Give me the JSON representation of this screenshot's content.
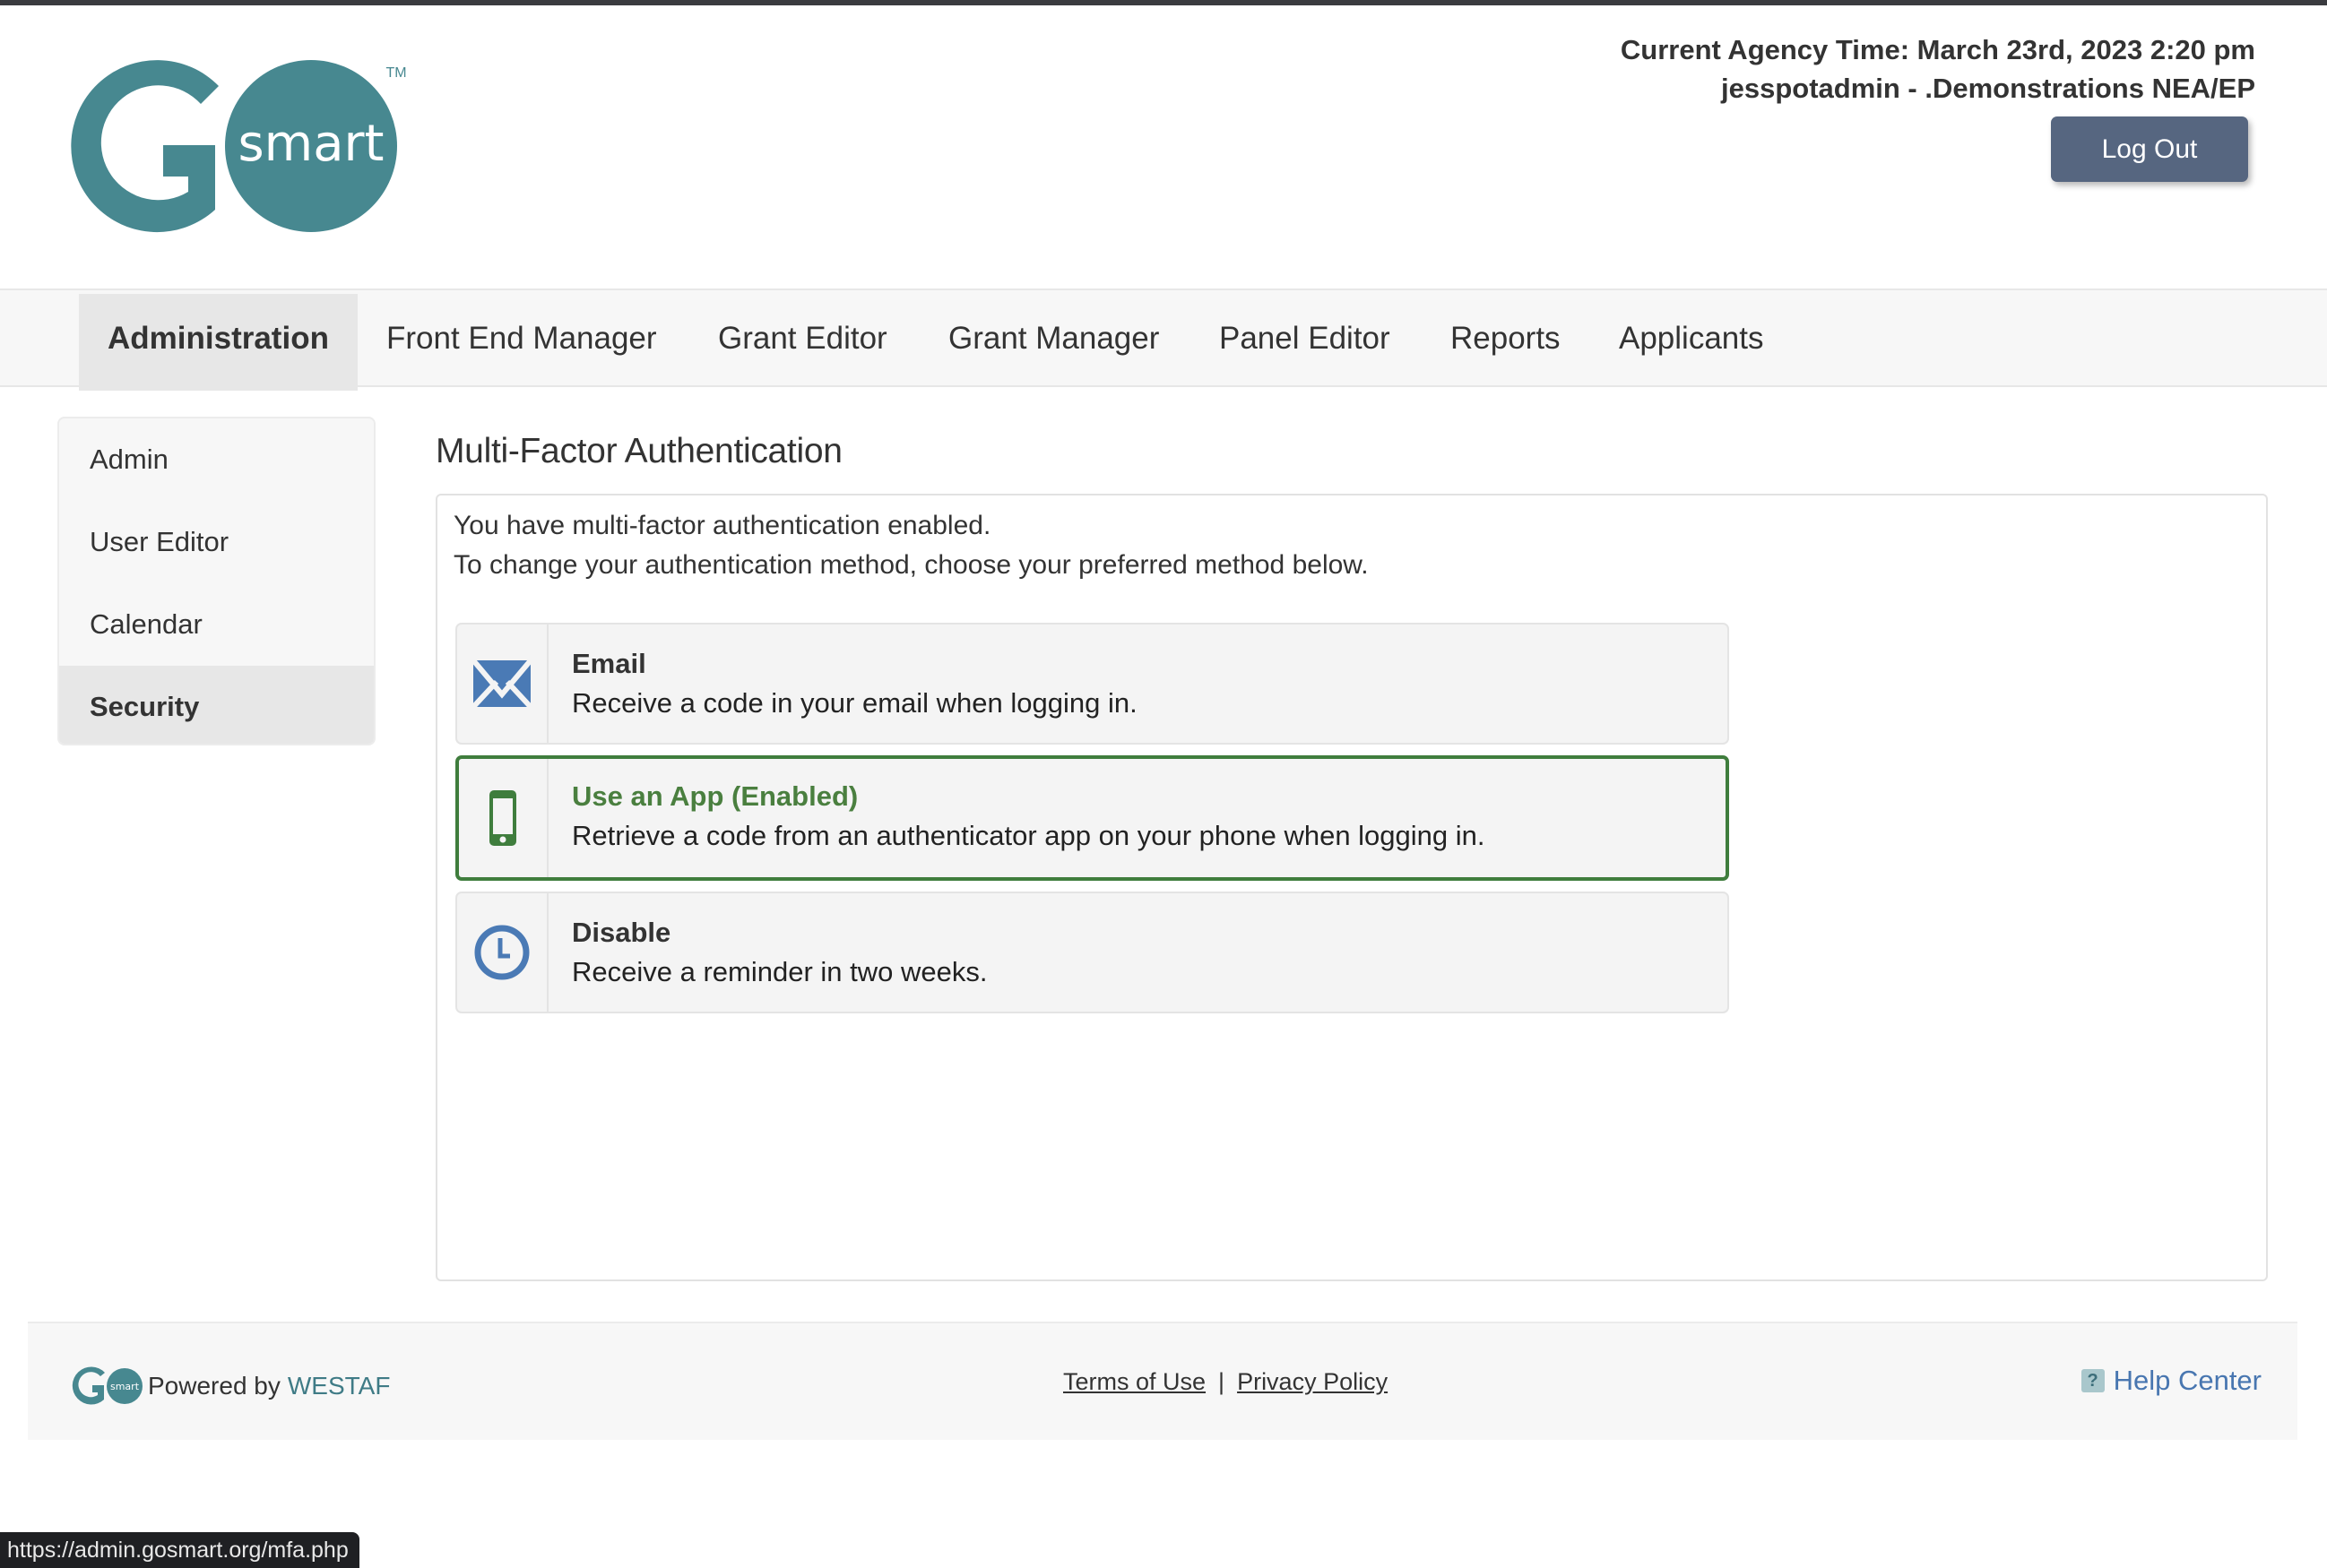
{
  "brand": {
    "logo_letter": "G",
    "logo_word": "smart",
    "trademark": "TM",
    "primary_color": "#478890"
  },
  "header": {
    "agency_time": "Current Agency Time: March 23rd, 2023 2:20 pm",
    "user_line": "jesspotadmin - .Demonstrations NEA/EP",
    "logout_label": "Log Out"
  },
  "nav": {
    "items": [
      {
        "label": "Administration",
        "active": true
      },
      {
        "label": "Front End Manager",
        "active": false
      },
      {
        "label": "Grant Editor",
        "active": false
      },
      {
        "label": "Grant Manager",
        "active": false
      },
      {
        "label": "Panel Editor",
        "active": false
      },
      {
        "label": "Reports",
        "active": false
      },
      {
        "label": "Applicants",
        "active": false
      }
    ]
  },
  "sidebar": {
    "items": [
      {
        "label": "Admin",
        "active": false
      },
      {
        "label": "User Editor",
        "active": false
      },
      {
        "label": "Calendar",
        "active": false
      },
      {
        "label": "Security",
        "active": true
      }
    ]
  },
  "main": {
    "title": "Multi-Factor Authentication",
    "intro_line1": "You have multi-factor authentication enabled.",
    "intro_line2": "To change your authentication method, choose your preferred method below.",
    "options": [
      {
        "icon": "envelope-icon",
        "title": "Email",
        "description": "Receive a code in your email when logging in.",
        "enabled": false,
        "icon_color": "#4a7ab5"
      },
      {
        "icon": "mobile-phone-icon",
        "title": "Use an App (Enabled)",
        "description": "Retrieve a code from an authenticator app on your phone when logging in.",
        "enabled": true,
        "icon_color": "#3f7d3d"
      },
      {
        "icon": "clock-icon",
        "title": "Disable",
        "description": "Receive a reminder in two weeks.",
        "enabled": false,
        "icon_color": "#4a7ab5"
      }
    ]
  },
  "footer": {
    "powered_by": "Powered by",
    "westaf": "WESTAF",
    "terms": "Terms of Use",
    "separator": "|",
    "privacy": "Privacy Policy",
    "help": "Help Center",
    "help_icon_glyph": "?"
  },
  "status_bar": {
    "url": "https://admin.gosmart.org/mfa.php"
  }
}
